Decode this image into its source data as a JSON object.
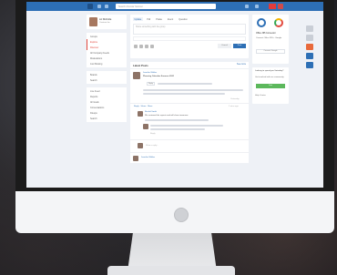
{
  "screen": {
    "search_placeholder": "Search Amosta Yammer",
    "profile": {
      "name": "Liz Mcbride",
      "subtitle": "Contoso Inc."
    },
    "nav_groups": [
      {
        "items": [
          "Groups",
          "Explore",
          "Discover",
          "All Company Feeds",
          "Moderations",
          "Just Sharing"
        ]
      },
      {
        "items": [
          "Boards",
          "Search"
        ]
      },
      {
        "items": [
          "Live Feed",
          "Reports",
          "All Goals",
          "Conversations",
          "Fileups",
          "Search"
        ]
      }
    ],
    "composer": {
      "tabs": [
        "Update",
        "Poll",
        "Praise",
        "Event",
        "Question"
      ],
      "placeholder": "Share something with the group",
      "cancel_label": "Cancel",
      "post_label": "Post"
    },
    "feed": {
      "title": "Latest Posts",
      "more_label": "See more",
      "posts": [
        {
          "author": "Jennifer Walker",
          "text": "Planning Calendar Summer 2021",
          "action": "Reply",
          "meta": "Yesterday"
        },
        {
          "author": "Like",
          "text": "Reply · Share · More",
          "meta": "2 mins ago"
        },
        {
          "author": "Rachel Smith",
          "text": "We reviewed the reports and will share tomorrow",
          "meta": "Reply"
        },
        {
          "author": "Jennifer Walker",
          "text": "Write a reply...",
          "meta": ""
        }
      ]
    },
    "right_card": {
      "title": "Office 365 Connector",
      "subtitle": "Connect Office 365 + Google",
      "button_label": "Connect Google"
    },
    "right_card2": {
      "title": "Looking to spend you Saturday?",
      "line": "Get involved with our community",
      "button_label": "Join",
      "footer": "Help Center"
    },
    "right_icons": [
      "gear-icon",
      "bell-icon",
      "office-icon",
      "chat-icon",
      "doc-icon"
    ]
  },
  "colors": {
    "brand": "#2d6fb5",
    "accent": "#e2483e",
    "success": "#5cb85c"
  }
}
